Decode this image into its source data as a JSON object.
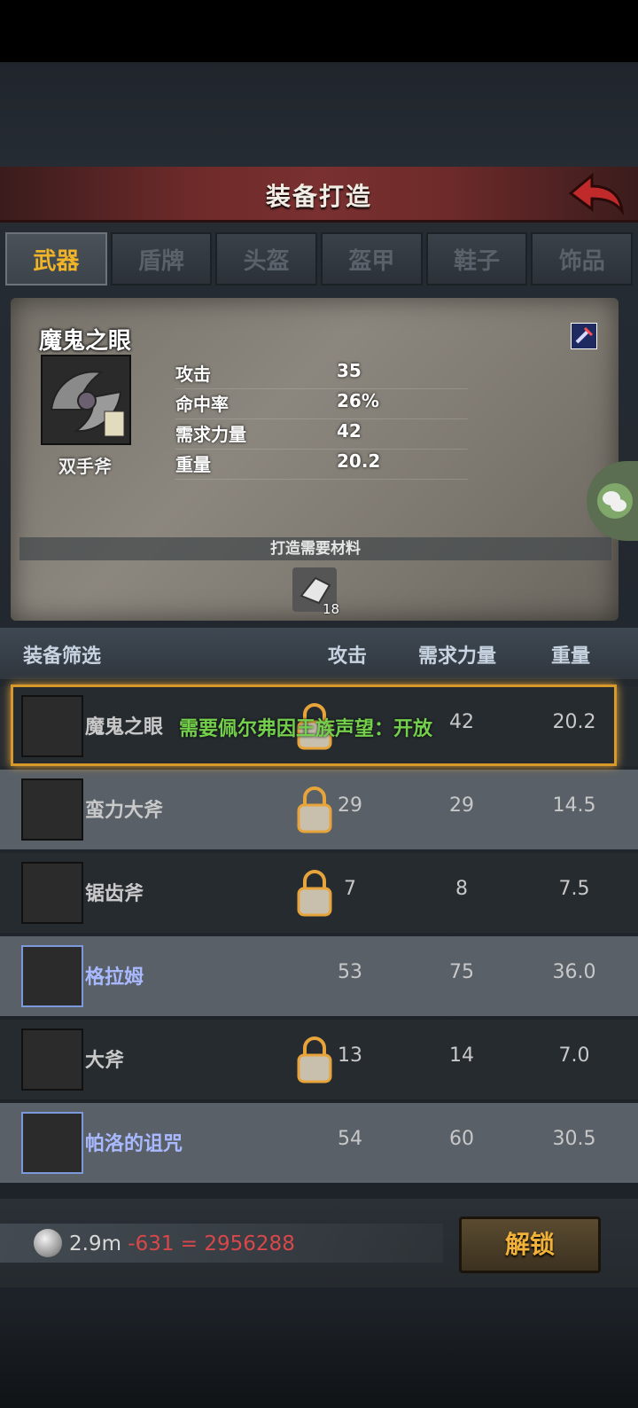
{
  "window": {
    "title": "装备打造"
  },
  "tabs": [
    {
      "label": "武器",
      "active": true
    },
    {
      "label": "盾牌",
      "active": false
    },
    {
      "label": "头盔",
      "active": false
    },
    {
      "label": "盔甲",
      "active": false
    },
    {
      "label": "鞋子",
      "active": false
    },
    {
      "label": "饰品",
      "active": false
    }
  ],
  "detail": {
    "name": "魔鬼之眼",
    "type": "双手斧",
    "stats": [
      {
        "label": "攻击",
        "value": "35"
      },
      {
        "label": "命中率",
        "value": "26%"
      },
      {
        "label": "需求力量",
        "value": "42"
      },
      {
        "label": "重量",
        "value": "20.2"
      }
    ],
    "materials_label": "打造需要材料",
    "material_count": "18"
  },
  "table": {
    "headers": {
      "filter": "装备筛选",
      "attack": "攻击",
      "strength": "需求力量",
      "weight": "重量"
    },
    "rows": [
      {
        "name": "魔鬼之眼",
        "attack": "",
        "strength": "42",
        "weight": "20.2",
        "locked": true,
        "rare": false
      },
      {
        "name": "蛮力大斧",
        "attack": "29",
        "strength": "29",
        "weight": "14.5",
        "locked": true,
        "rare": false
      },
      {
        "name": "锯齿斧",
        "attack": "7",
        "strength": "8",
        "weight": "7.5",
        "locked": true,
        "rare": false
      },
      {
        "name": "格拉姆",
        "attack": "53",
        "strength": "75",
        "weight": "36.0",
        "locked": false,
        "rare": true
      },
      {
        "name": "大斧",
        "attack": "13",
        "strength": "14",
        "weight": "7.0",
        "locked": true,
        "rare": false
      },
      {
        "name": "帕洛的诅咒",
        "attack": "54",
        "strength": "60",
        "weight": "30.5",
        "locked": false,
        "rare": true
      }
    ],
    "selected_message": "需要佩尔弗因王族声望：开放"
  },
  "footer": {
    "money": "2.9m",
    "cost": "-631 = 2956288",
    "unlock_label": "解锁"
  },
  "colors": {
    "accent": "#f0b428",
    "message": "#74d04c",
    "negative": "#d8484a"
  }
}
